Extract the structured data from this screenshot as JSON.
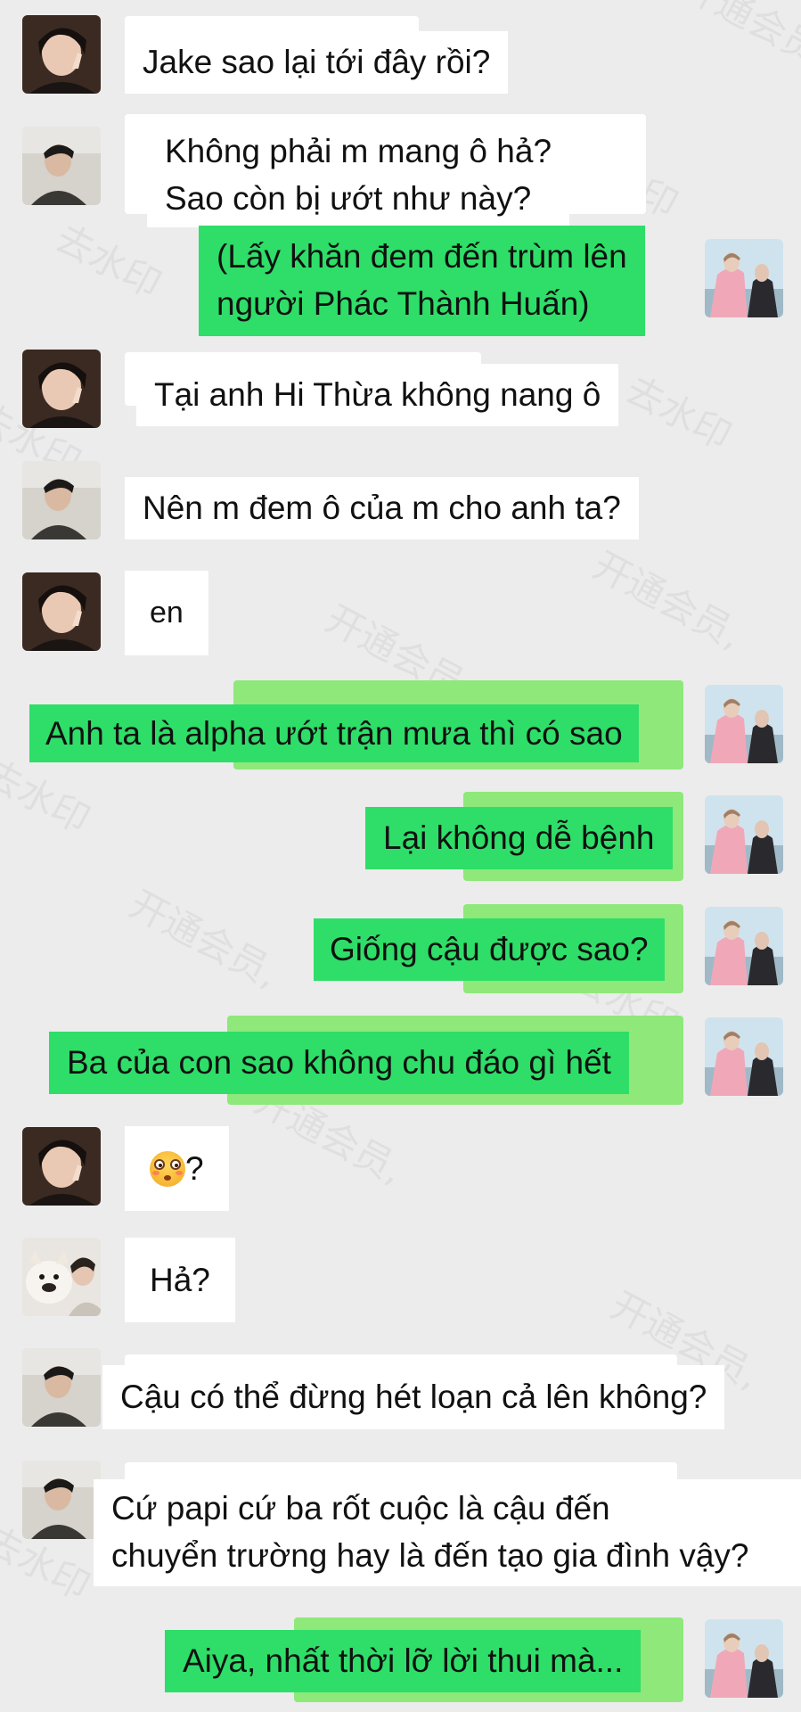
{
  "watermark": {
    "text_a": "开通会员,",
    "text_b": "去水印"
  },
  "messages": [
    {
      "id": "m1",
      "side": "left",
      "avatar": "avatar-a",
      "lines": [
        "Jake sao lại tới đây rồi?"
      ]
    },
    {
      "id": "m2",
      "side": "left",
      "avatar": "avatar-b",
      "lines": [
        "Không phải m mang ô hả?",
        "Sao còn bị ướt như này?"
      ]
    },
    {
      "id": "m3",
      "side": "right",
      "avatar": "avatar-me",
      "lines": [
        "(Lấy khăn đem đến trùm lên",
        "người Phác Thành Huấn)"
      ]
    },
    {
      "id": "m4",
      "side": "left",
      "avatar": "avatar-a",
      "lines": [
        "Tại anh Hi Thừa không nang ô"
      ]
    },
    {
      "id": "m5",
      "side": "left",
      "avatar": "avatar-b",
      "lines": [
        "Nên m đem ô của m cho anh ta?"
      ]
    },
    {
      "id": "m6",
      "side": "left",
      "avatar": "avatar-a",
      "lines": [
        "en"
      ]
    },
    {
      "id": "m7",
      "side": "right",
      "avatar": "avatar-me",
      "lines": [
        "Anh ta là alpha ướt trận mưa thì có sao"
      ]
    },
    {
      "id": "m8",
      "side": "right",
      "avatar": "avatar-me",
      "lines": [
        "Lại không dễ bệnh"
      ]
    },
    {
      "id": "m9",
      "side": "right",
      "avatar": "avatar-me",
      "lines": [
        "Giống cậu được sao?"
      ]
    },
    {
      "id": "m10",
      "side": "right",
      "avatar": "avatar-me",
      "lines": [
        "Ba của con sao không chu đáo gì hết"
      ]
    },
    {
      "id": "m11",
      "side": "left",
      "avatar": "avatar-a",
      "emoji": "flushed-face",
      "lines": [
        "?"
      ]
    },
    {
      "id": "m12",
      "side": "left",
      "avatar": "avatar-c",
      "lines": [
        "Hả?"
      ]
    },
    {
      "id": "m13",
      "side": "left",
      "avatar": "avatar-b",
      "lines": [
        "Cậu có thể đừng hét loạn cả lên không?"
      ]
    },
    {
      "id": "m14",
      "side": "left",
      "avatar": "avatar-b",
      "lines": [
        "Cứ papi cứ ba rốt cuộc là cậu đến",
        "chuyển trường hay là đến tạo gia đình vậy?"
      ]
    },
    {
      "id": "m15",
      "side": "right",
      "avatar": "avatar-me",
      "lines": [
        "Aiya, nhất thời lỡ lời thui mà..."
      ]
    }
  ],
  "colors": {
    "background": "#ececec",
    "incoming_bubble": "#ffffff",
    "outgoing_bubble": "#2ede68"
  }
}
